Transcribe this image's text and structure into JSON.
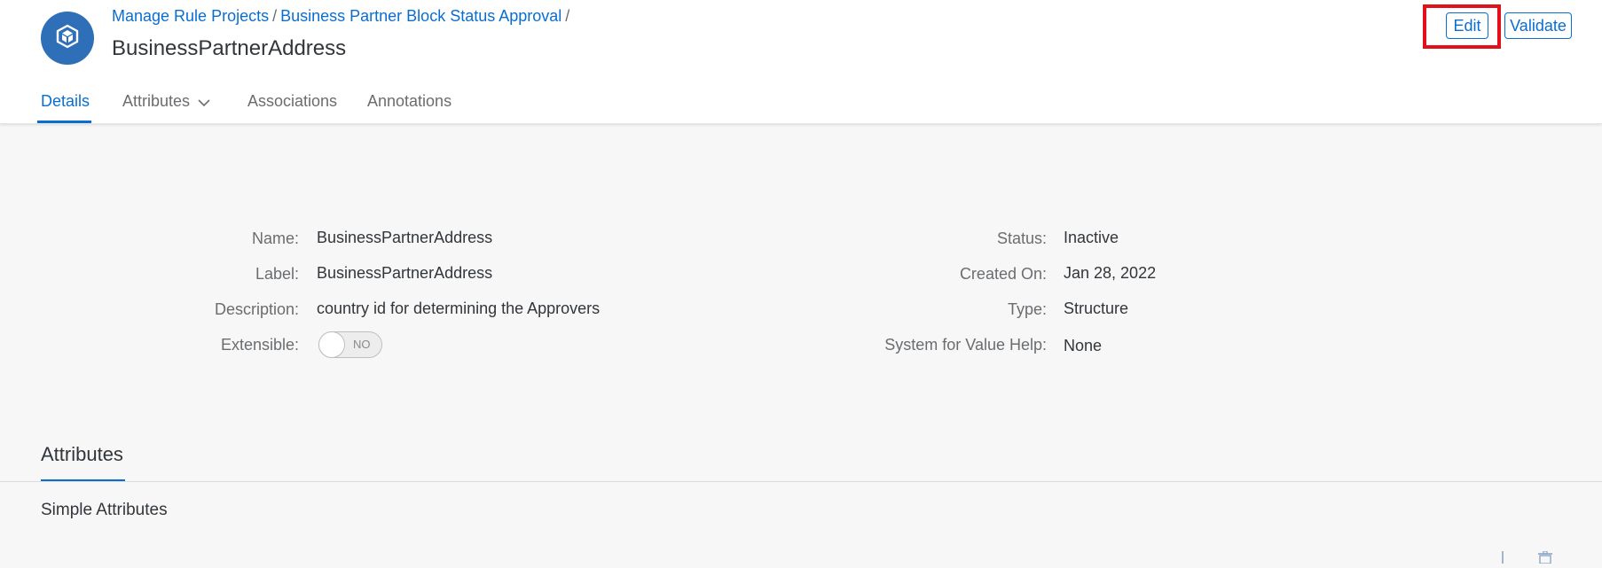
{
  "header": {
    "breadcrumb": [
      {
        "label": "Manage Rule Projects"
      },
      {
        "label": "Business Partner Block Status Approval"
      }
    ],
    "separator": "/",
    "title": "BusinessPartnerAddress",
    "actions": {
      "edit_label": "Edit",
      "validate_label": "Validate"
    },
    "avatar_icon": "cube-icon"
  },
  "tabs": [
    {
      "label": "Details",
      "active": true
    },
    {
      "label": "Attributes",
      "has_dropdown": true
    },
    {
      "label": "Associations"
    },
    {
      "label": "Annotations"
    }
  ],
  "details": {
    "left": [
      {
        "label": "Name:",
        "value": "BusinessPartnerAddress"
      },
      {
        "label": "Label:",
        "value": "BusinessPartnerAddress"
      },
      {
        "label": "Description:",
        "value": "country id for determining the Approvers"
      },
      {
        "label": "Extensible:",
        "toggle_text": "NO",
        "toggle_on": false
      }
    ],
    "right": [
      {
        "label": "Status:",
        "value": "Inactive"
      },
      {
        "label": "Created On:",
        "value": "Jan 28, 2022"
      },
      {
        "label": "Type:",
        "value": "Structure"
      },
      {
        "label": "System for Value Help:",
        "value": "None"
      }
    ]
  },
  "attributes_section": {
    "title": "Attributes",
    "subsection_title": "Simple Attributes"
  },
  "colors": {
    "accent": "#0a6ed1",
    "avatar": "#2f6fb8",
    "highlight": "#e1101b"
  }
}
